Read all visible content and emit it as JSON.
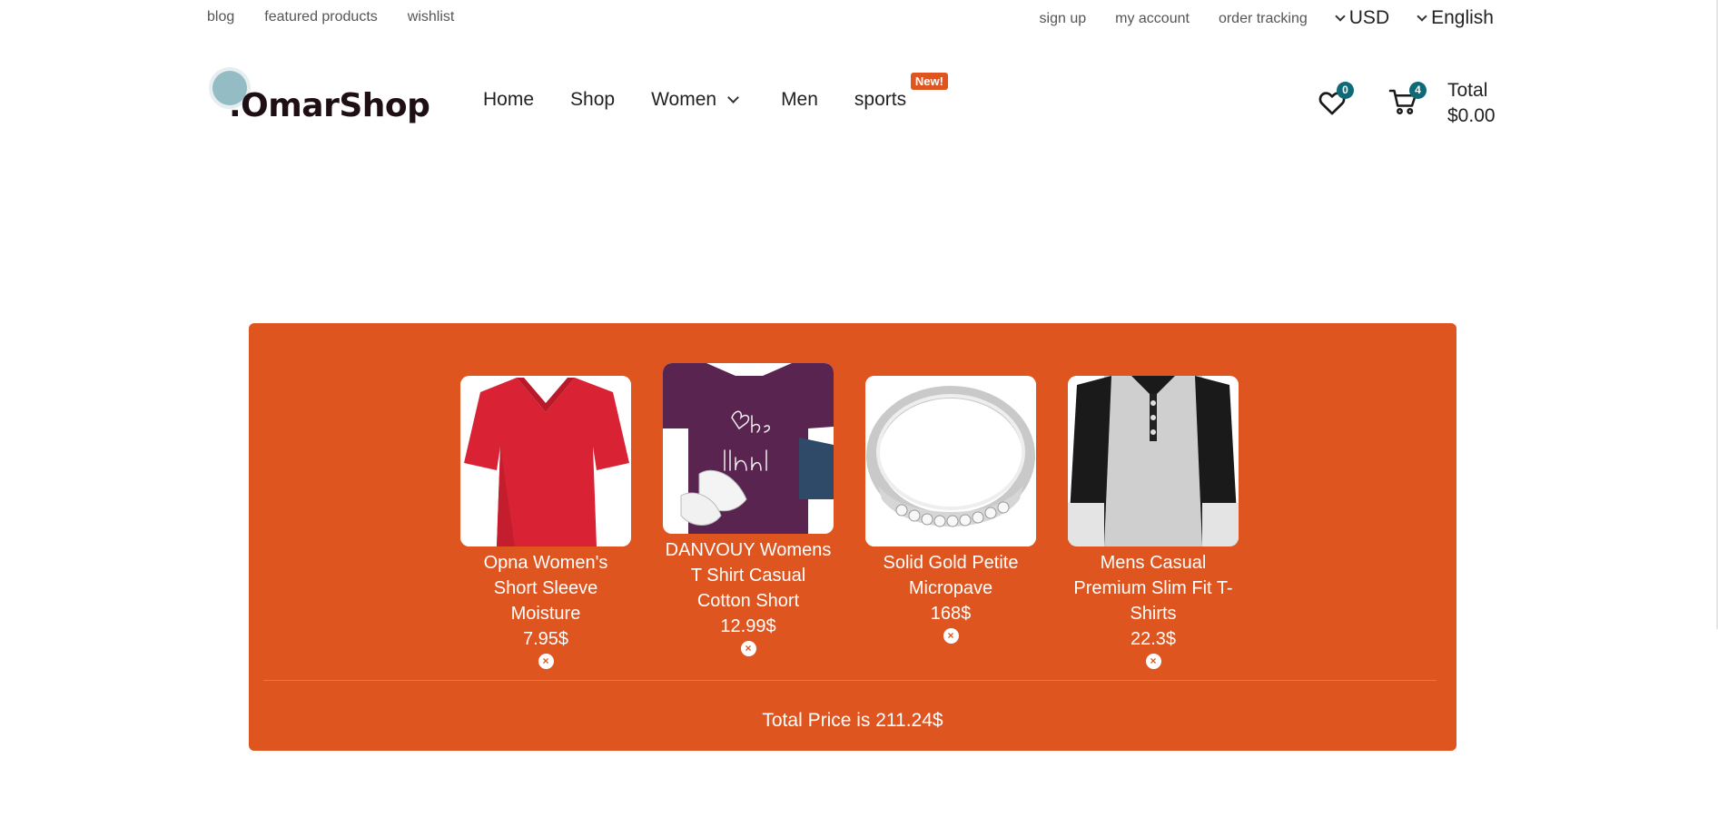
{
  "topbar": {
    "left_links": [
      "blog",
      "featured products",
      "wishlist"
    ],
    "right_links": [
      "sign up",
      "my account",
      "order tracking"
    ],
    "currency": "USD",
    "language": "English"
  },
  "header": {
    "logo_text": ".OmarShop",
    "nav": {
      "home": "Home",
      "shop": "Shop",
      "women": "Women",
      "men": "Men",
      "sports": "sports",
      "sports_badge": "New!"
    },
    "wishlist_count": "0",
    "cart_count": "4",
    "total_label": "Total",
    "total_value": "$0.00"
  },
  "cart": {
    "items": [
      {
        "name": "Opna Women's Short Sleeve Moisture",
        "price": "7.95$"
      },
      {
        "name": "DANVOUY Womens T Shirt Casual Cotton Short",
        "price": "12.99$"
      },
      {
        "name": "Solid Gold Petite Micropave",
        "price": "168$"
      },
      {
        "name": "Mens Casual Premium Slim Fit T-Shirts",
        "price": "22.3$"
      }
    ],
    "remove_symbol": "×",
    "total_text": "Total Price is 211.24$"
  },
  "colors": {
    "accent": "#df5520",
    "badge": "#0f6a77",
    "logo_dot": "#94bcc4"
  }
}
